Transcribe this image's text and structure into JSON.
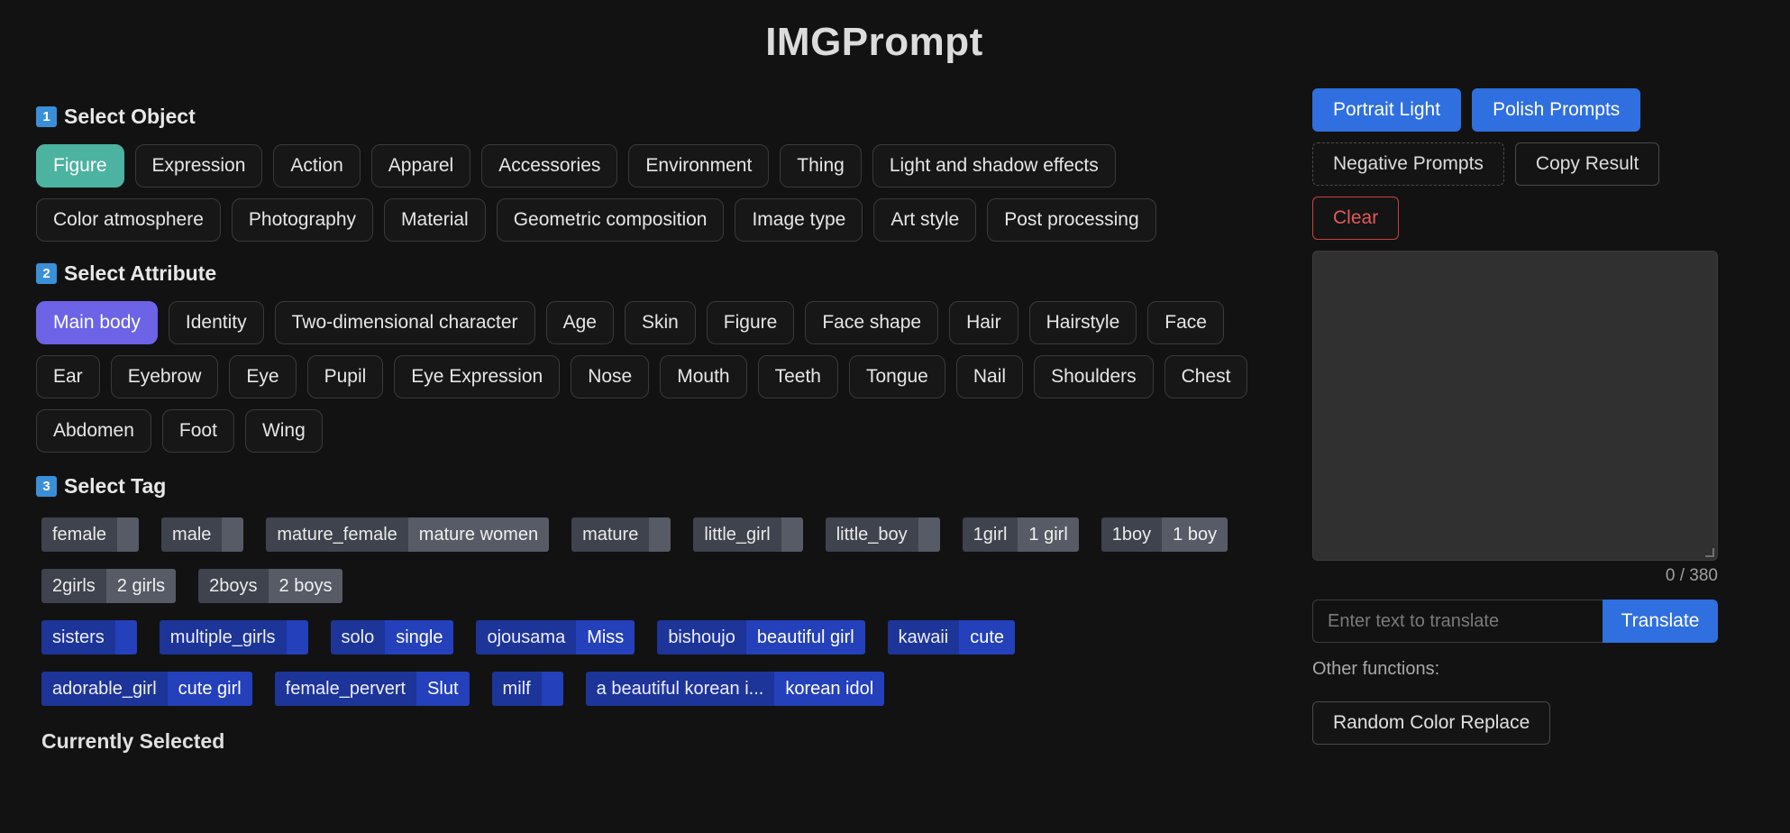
{
  "app": {
    "title": "IMGPrompt"
  },
  "sections": {
    "object": {
      "num": "1",
      "title": "Select Object"
    },
    "attribute": {
      "num": "2",
      "title": "Select Attribute"
    },
    "tag": {
      "num": "3",
      "title": "Select Tag"
    },
    "current": {
      "title": "Currently Selected"
    }
  },
  "objects": [
    "Figure",
    "Expression",
    "Action",
    "Apparel",
    "Accessories",
    "Environment",
    "Thing",
    "Light and shadow effects",
    "Color atmosphere",
    "Photography",
    "Material",
    "Geometric composition",
    "Image type",
    "Art style",
    "Post processing"
  ],
  "attributes": [
    "Main body",
    "Identity",
    "Two-dimensional character",
    "Age",
    "Skin",
    "Figure",
    "Face shape",
    "Hair",
    "Hairstyle",
    "Face",
    "Ear",
    "Eyebrow",
    "Eye",
    "Pupil",
    "Eye Expression",
    "Nose",
    "Mouth",
    "Teeth",
    "Tongue",
    "Nail",
    "Shoulders",
    "Chest",
    "Abdomen",
    "Foot",
    "Wing"
  ],
  "tags": [
    [
      {
        "en": "female",
        "zh": ""
      },
      {
        "en": "male",
        "zh": ""
      },
      {
        "en": "mature_female",
        "zh": "mature women"
      },
      {
        "en": "mature",
        "zh": ""
      },
      {
        "en": "little_girl",
        "zh": ""
      },
      {
        "en": "little_boy",
        "zh": ""
      },
      {
        "en": "1girl",
        "zh": "1 girl"
      },
      {
        "en": "1boy",
        "zh": "1 boy"
      }
    ],
    [
      {
        "en": "2girls",
        "zh": "2 girls"
      },
      {
        "en": "2boys",
        "zh": "2 boys"
      }
    ],
    [
      {
        "en": "sisters",
        "zh": ""
      },
      {
        "en": "multiple_girls",
        "zh": ""
      },
      {
        "en": "solo",
        "zh": "single"
      },
      {
        "en": "ojousama",
        "zh": "Miss"
      },
      {
        "en": "bishoujo",
        "zh": "beautiful girl"
      },
      {
        "en": "kawaii",
        "zh": "cute"
      }
    ],
    [
      {
        "en": "adorable_girl",
        "zh": "cute girl"
      },
      {
        "en": "female_pervert",
        "zh": "Slut"
      },
      {
        "en": "milf",
        "zh": ""
      },
      {
        "en": "a beautiful korean i...",
        "zh": "korean idol"
      }
    ]
  ],
  "right": {
    "portrait_light": "Portrait Light",
    "polish_prompts": "Polish Prompts",
    "negative_prompts": "Negative Prompts",
    "copy_result": "Copy Result",
    "clear": "Clear",
    "result_text": "",
    "counter": "0 / 380",
    "translate_placeholder": "Enter text to translate",
    "translate_button": "Translate",
    "other_label": "Other functions:",
    "random_color": "Random Color Replace"
  },
  "colors": {
    "accent_teal": "#4bb3a0",
    "accent_purple": "#6c63e6",
    "primary_blue": "#2f6fe0",
    "danger_red": "#e35a5a"
  }
}
